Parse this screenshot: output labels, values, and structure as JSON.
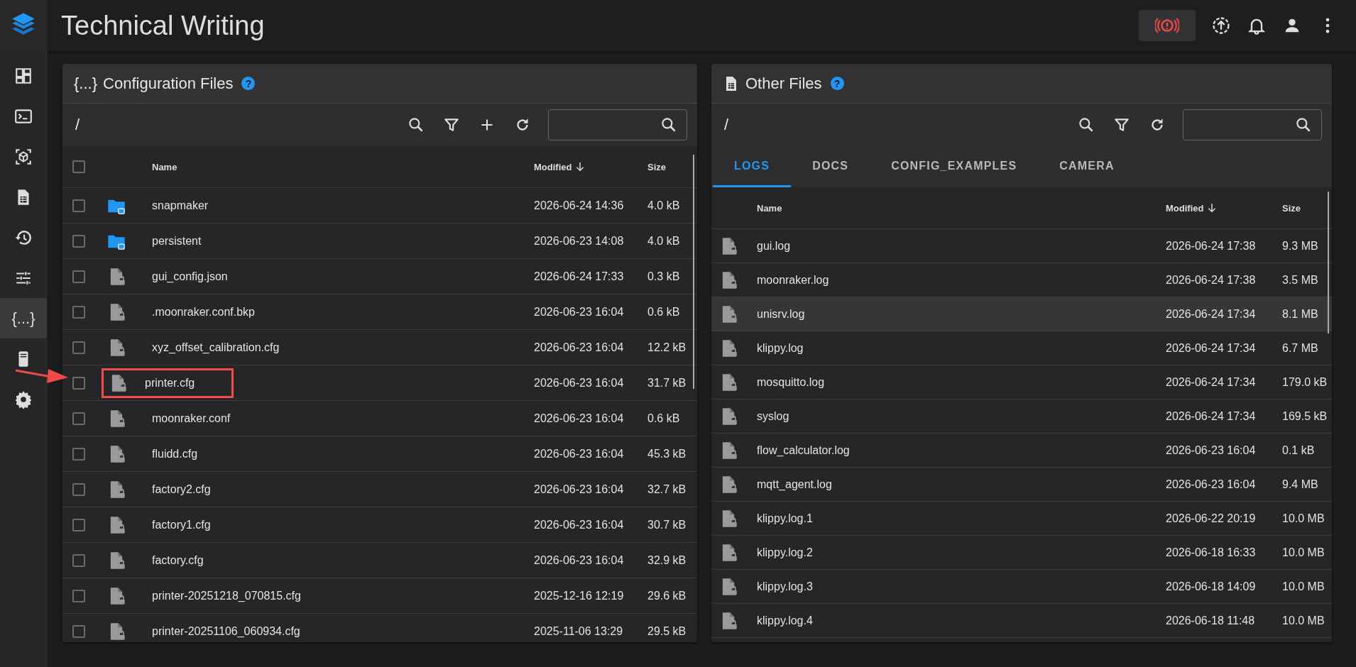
{
  "app_bar": {
    "title": "Technical Writing"
  },
  "sidebar": {
    "items": [
      {
        "kind": "dashboard",
        "selected": false
      },
      {
        "kind": "console",
        "selected": false
      },
      {
        "kind": "cube",
        "selected": false
      },
      {
        "kind": "sheet",
        "selected": false
      },
      {
        "kind": "history",
        "selected": false
      },
      {
        "kind": "tune",
        "selected": false
      },
      {
        "kind": "glyph",
        "glyph": "{...}",
        "selected": true
      },
      {
        "kind": "server",
        "selected": false
      },
      {
        "kind": "gear",
        "selected": false
      }
    ]
  },
  "config_panel": {
    "glyph": "{...}",
    "title": "Configuration Files",
    "help": "?",
    "path": "/",
    "select_all_checked": false,
    "columns": [
      "Name",
      "Modified",
      "Size"
    ],
    "rows": [
      {
        "kind": "folder",
        "name": "snapmaker",
        "modified": "2026-06-24 14:36",
        "size": "4.0 kB",
        "checked": false,
        "highlighted": false
      },
      {
        "kind": "folder",
        "name": "persistent",
        "modified": "2026-06-23 14:08",
        "size": "4.0 kB",
        "checked": false,
        "highlighted": false
      },
      {
        "kind": "file",
        "name": "gui_config.json",
        "modified": "2026-06-24 17:33",
        "size": "0.3 kB",
        "checked": false,
        "highlighted": false
      },
      {
        "kind": "file",
        "name": ".moonraker.conf.bkp",
        "modified": "2026-06-23 16:04",
        "size": "0.6 kB",
        "checked": false,
        "highlighted": false
      },
      {
        "kind": "file",
        "name": "xyz_offset_calibration.cfg",
        "modified": "2026-06-23 16:04",
        "size": "12.2 kB",
        "checked": false,
        "highlighted": false
      },
      {
        "kind": "file",
        "name": "printer.cfg",
        "modified": "2026-06-23 16:04",
        "size": "31.7 kB",
        "checked": false,
        "highlighted": true
      },
      {
        "kind": "file",
        "name": "moonraker.conf",
        "modified": "2026-06-23 16:04",
        "size": "0.6 kB",
        "checked": false,
        "highlighted": false
      },
      {
        "kind": "file",
        "name": "fluidd.cfg",
        "modified": "2026-06-23 16:04",
        "size": "45.3 kB",
        "checked": false,
        "highlighted": false
      },
      {
        "kind": "file",
        "name": "factory2.cfg",
        "modified": "2026-06-23 16:04",
        "size": "32.7 kB",
        "checked": false,
        "highlighted": false
      },
      {
        "kind": "file",
        "name": "factory1.cfg",
        "modified": "2026-06-23 16:04",
        "size": "30.7 kB",
        "checked": false,
        "highlighted": false
      },
      {
        "kind": "file",
        "name": "factory.cfg",
        "modified": "2026-06-23 16:04",
        "size": "32.9 kB",
        "checked": false,
        "highlighted": false
      },
      {
        "kind": "file",
        "name": "printer-20251218_070815.cfg",
        "modified": "2025-12-16 12:19",
        "size": "29.6 kB",
        "checked": false,
        "highlighted": false
      },
      {
        "kind": "file",
        "name": "printer-20251106_060934.cfg",
        "modified": "2025-11-06 13:29",
        "size": "29.5 kB",
        "checked": false,
        "highlighted": false
      }
    ]
  },
  "other_panel": {
    "title": "Other Files",
    "help": "?",
    "path": "/",
    "tabs": [
      {
        "label": "LOGS",
        "selected": true
      },
      {
        "label": "DOCS",
        "selected": false
      },
      {
        "label": "CONFIG_EXAMPLES",
        "selected": false
      },
      {
        "label": "CAMERA",
        "selected": false
      }
    ],
    "columns": [
      "Name",
      "Modified",
      "Size"
    ],
    "rows": [
      {
        "name": "gui.log",
        "modified": "2026-06-24 17:38",
        "size": "9.3 MB",
        "selected": false
      },
      {
        "name": "moonraker.log",
        "modified": "2026-06-24 17:38",
        "size": "3.5 MB",
        "selected": false
      },
      {
        "name": "unisrv.log",
        "modified": "2026-06-24 17:34",
        "size": "8.1 MB",
        "selected": true
      },
      {
        "name": "klippy.log",
        "modified": "2026-06-24 17:34",
        "size": "6.7 MB",
        "selected": false
      },
      {
        "name": "mosquitto.log",
        "modified": "2026-06-24 17:34",
        "size": "179.0 kB",
        "selected": false
      },
      {
        "name": "syslog",
        "modified": "2026-06-24 17:34",
        "size": "169.5 kB",
        "selected": false
      },
      {
        "name": "flow_calculator.log",
        "modified": "2026-06-23 16:04",
        "size": "0.1 kB",
        "selected": false
      },
      {
        "name": "mqtt_agent.log",
        "modified": "2026-06-23 16:04",
        "size": "9.4 MB",
        "selected": false
      },
      {
        "name": "klippy.log.1",
        "modified": "2026-06-22 20:19",
        "size": "10.0 MB",
        "selected": false
      },
      {
        "name": "klippy.log.2",
        "modified": "2026-06-18 16:33",
        "size": "10.0 MB",
        "selected": false
      },
      {
        "name": "klippy.log.3",
        "modified": "2026-06-18 14:09",
        "size": "10.0 MB",
        "selected": false
      },
      {
        "name": "klippy.log.4",
        "modified": "2026-06-18 11:48",
        "size": "10.0 MB",
        "selected": false
      }
    ]
  }
}
